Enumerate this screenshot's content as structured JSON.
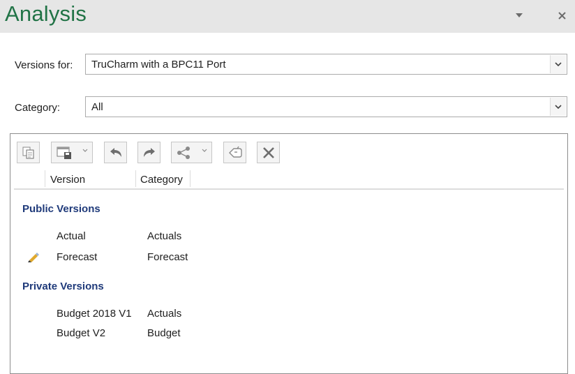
{
  "header": {
    "title": "Analysis"
  },
  "versions_for": {
    "label": "Versions for:",
    "value": "TruCharm with a BPC11 Port"
  },
  "category": {
    "label": "Category:",
    "value": "All"
  },
  "table": {
    "columns": [
      "Version",
      "Category"
    ],
    "groups": [
      {
        "name": "Public Versions",
        "rows": [
          {
            "version": "Actual",
            "category": "Actuals",
            "editing": false
          },
          {
            "version": "Forecast",
            "category": "Forecast",
            "editing": true
          }
        ]
      },
      {
        "name": "Private Versions",
        "rows": [
          {
            "version": "Budget 2018 V1",
            "category": "Actuals",
            "editing": false
          },
          {
            "version": "Budget V2",
            "category": "Budget",
            "editing": false
          }
        ]
      }
    ]
  },
  "toolbar": {
    "icons": [
      "copy-icon",
      "save-as-icon",
      "undo-icon",
      "redo-icon",
      "share-icon",
      "rollback-icon",
      "delete-icon"
    ]
  },
  "colors": {
    "title": "#217346",
    "group_header": "#1f3a7a",
    "edit_pencil": "#e0a92e"
  }
}
